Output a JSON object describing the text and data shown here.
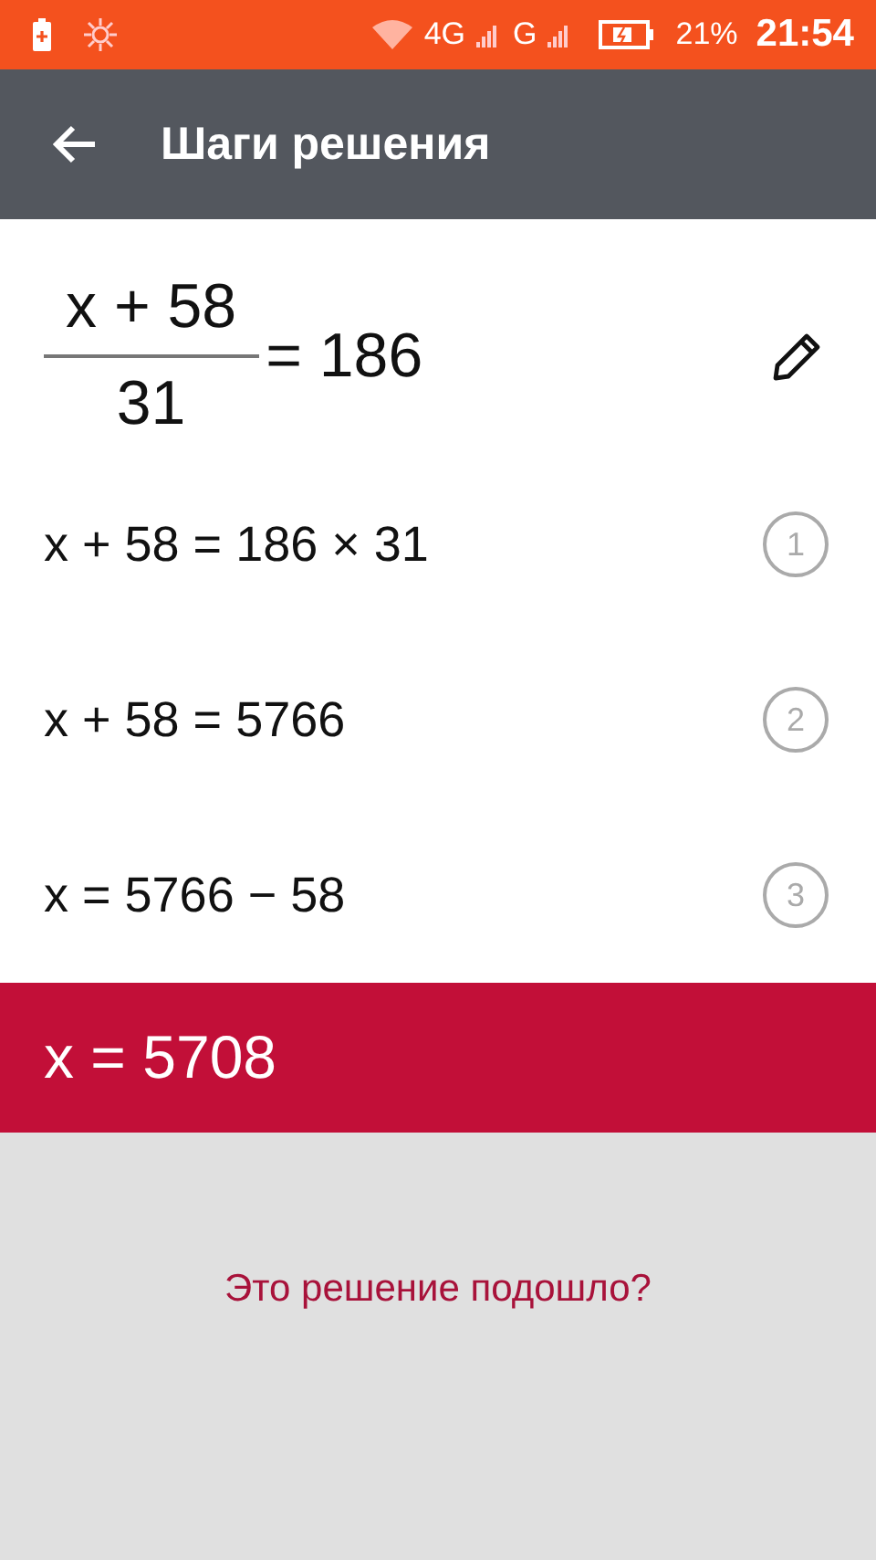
{
  "status_bar": {
    "network": "4G",
    "network_2": "G",
    "battery": "21%",
    "time": "21:54"
  },
  "app_bar": {
    "title": "Шаги решения"
  },
  "problem": {
    "numerator": "x + 58",
    "denominator": "31",
    "right_side": "= 186"
  },
  "steps": [
    {
      "expression": "x + 58 = 186 × 31",
      "number": "1"
    },
    {
      "expression": "x + 58 = 5766",
      "number": "2"
    },
    {
      "expression": "x = 5766 − 58",
      "number": "3"
    }
  ],
  "result": "x = 5708",
  "feedback": "Это решение подошло?"
}
